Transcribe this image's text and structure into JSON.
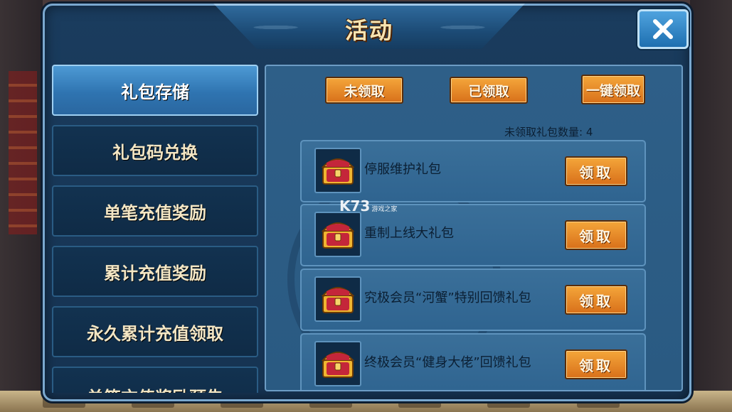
{
  "window": {
    "title": "活动",
    "close_icon": "close-x-icon"
  },
  "sidebar": {
    "items": [
      {
        "label": "礼包存储",
        "active": true
      },
      {
        "label": "礼包码兑换",
        "active": false
      },
      {
        "label": "单笔充值奖励",
        "active": false
      },
      {
        "label": "累计充值奖励",
        "active": false
      },
      {
        "label": "永久累计充值领取",
        "active": false
      },
      {
        "label": "单笔充值奖励预告",
        "active": false
      }
    ]
  },
  "tabs": [
    {
      "label": "未领取"
    },
    {
      "label": "已领取"
    },
    {
      "label": "一键领取"
    }
  ],
  "unclaimed_count_label": "未领取礼包数量: 4",
  "gifts": [
    {
      "name": "停服维护礼包",
      "button": "领取",
      "icon": "treasure-chest-icon"
    },
    {
      "name": "重制上线大礼包",
      "button": "领取",
      "icon": "treasure-chest-icon"
    },
    {
      "name": "究极会员“河蟹”特别回馈礼包",
      "button": "领取",
      "icon": "treasure-chest-icon"
    },
    {
      "name": "终极会员“健身大佬”回馈礼包",
      "button": "领取",
      "icon": "treasure-chest-icon"
    }
  ],
  "watermark": {
    "brand": "K73",
    "tagline": "游戏之家"
  },
  "colors": {
    "accent_orange": "#d8701a",
    "panel_blue": "#1a3c5e",
    "active_tab_blue": "#2f74b1",
    "title_gold": "#f8e3b0"
  }
}
